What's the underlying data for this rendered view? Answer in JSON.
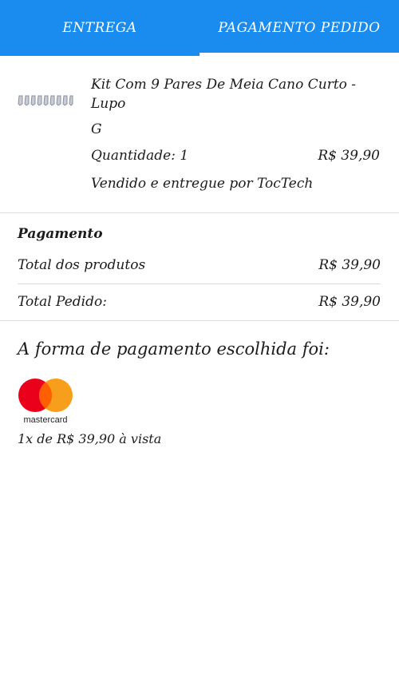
{
  "tabs": {
    "delivery": "ENTREGA",
    "payment": "PAGAMENTO PEDIDO"
  },
  "product": {
    "thumbnail_icon": "socks-icon",
    "title": "Kit Com 9 Pares De Meia Cano Curto - Lupo",
    "size": "G",
    "quantity": "Quantidade: 1",
    "price": "R$ 39,90",
    "seller": "Vendido e entregue por TocTech"
  },
  "payment": {
    "title": "Pagamento",
    "products_label": "Total dos produtos",
    "products_value": "R$ 39,90",
    "total_label": "Total Pedido:",
    "total_value": "R$ 39,90"
  },
  "method": {
    "title": "A forma de pagamento escolhida foi:",
    "brand": "mastercard",
    "brand_colors": [
      "#eb001b",
      "#f79e1b",
      "#ff5f00"
    ],
    "installments": "1x de R$ 39,90 à vista"
  },
  "colors": {
    "accent": "#1a8cf0"
  }
}
